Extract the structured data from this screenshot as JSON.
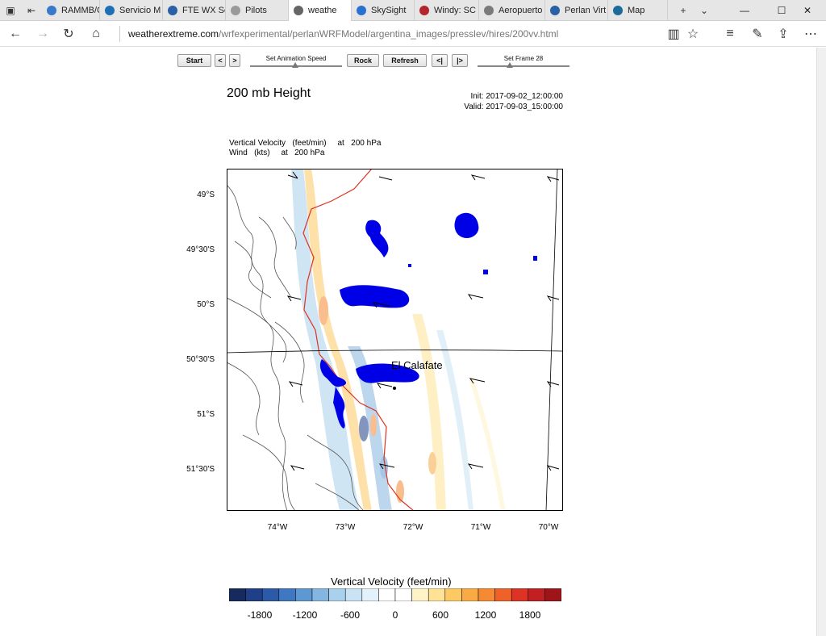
{
  "browser": {
    "tabs": [
      {
        "label": "RAMMB/C",
        "color": "#3a78c9"
      },
      {
        "label": "Servicio M",
        "color": "#1f6fb5"
      },
      {
        "label": "FTE WX Sc",
        "color": "#2b5fa6"
      },
      {
        "label": "Pilots",
        "color": "#9a9a9a"
      },
      {
        "label": "weathe",
        "color": "#666666"
      },
      {
        "label": "SkySight",
        "color": "#2a6fd1"
      },
      {
        "label": "Windy: SC",
        "color": "#b3262d"
      },
      {
        "label": "Aeropuerto",
        "color": "#7a7a7a"
      },
      {
        "label": "Perlan Virt",
        "color": "#2b5fa6"
      },
      {
        "label": "Map",
        "color": "#1c6b9a"
      }
    ],
    "url_domain": "weatherextreme.com",
    "url_path": "/wrfexperimental/perlanWRFModel/argentina_images/presslev/hires/200vv.html"
  },
  "controls": {
    "start": "Start",
    "prev": "<",
    "next": ">",
    "anim_speed": "Set Animation Speed",
    "rock": "Rock",
    "refresh": "Refresh",
    "first": "<|",
    "last": "|>",
    "set_frame": "Set Frame 28"
  },
  "plot": {
    "title": "200 mb Height",
    "init": "Init: 2017-09-02_12:00:00",
    "valid": "Valid: 2017-09-03_15:00:00",
    "desc_line1": "Vertical Velocity   (feet/min)     at   200 hPa",
    "desc_line2": "Wind   (kts)     at   200 hPa",
    "place": "El Calafate",
    "lat_labels": [
      "49°S",
      "49°30'S",
      "50°S",
      "50°30'S",
      "51°S",
      "51°30'S"
    ],
    "lon_labels": [
      "74°W",
      "73°W",
      "72°W",
      "71°W",
      "70°W"
    ],
    "colorbar_title": "Vertical Velocity  (feet/min)",
    "colorbar_labels": [
      "-1800",
      "-1200",
      "-600",
      "0",
      "600",
      "1200",
      "1800"
    ],
    "colorbar_colors": [
      "#162a5e",
      "#1f3f88",
      "#2a5aa8",
      "#3f78c0",
      "#5d98d2",
      "#84b6e0",
      "#a9d0ec",
      "#c9e3f4",
      "#e3f1fa",
      "#ffffff",
      "#ffffff",
      "#fff3c7",
      "#ffe296",
      "#fcc964",
      "#f9aa45",
      "#f68a33",
      "#ee6229",
      "#dc3324",
      "#c11f22",
      "#9d1518"
    ]
  }
}
